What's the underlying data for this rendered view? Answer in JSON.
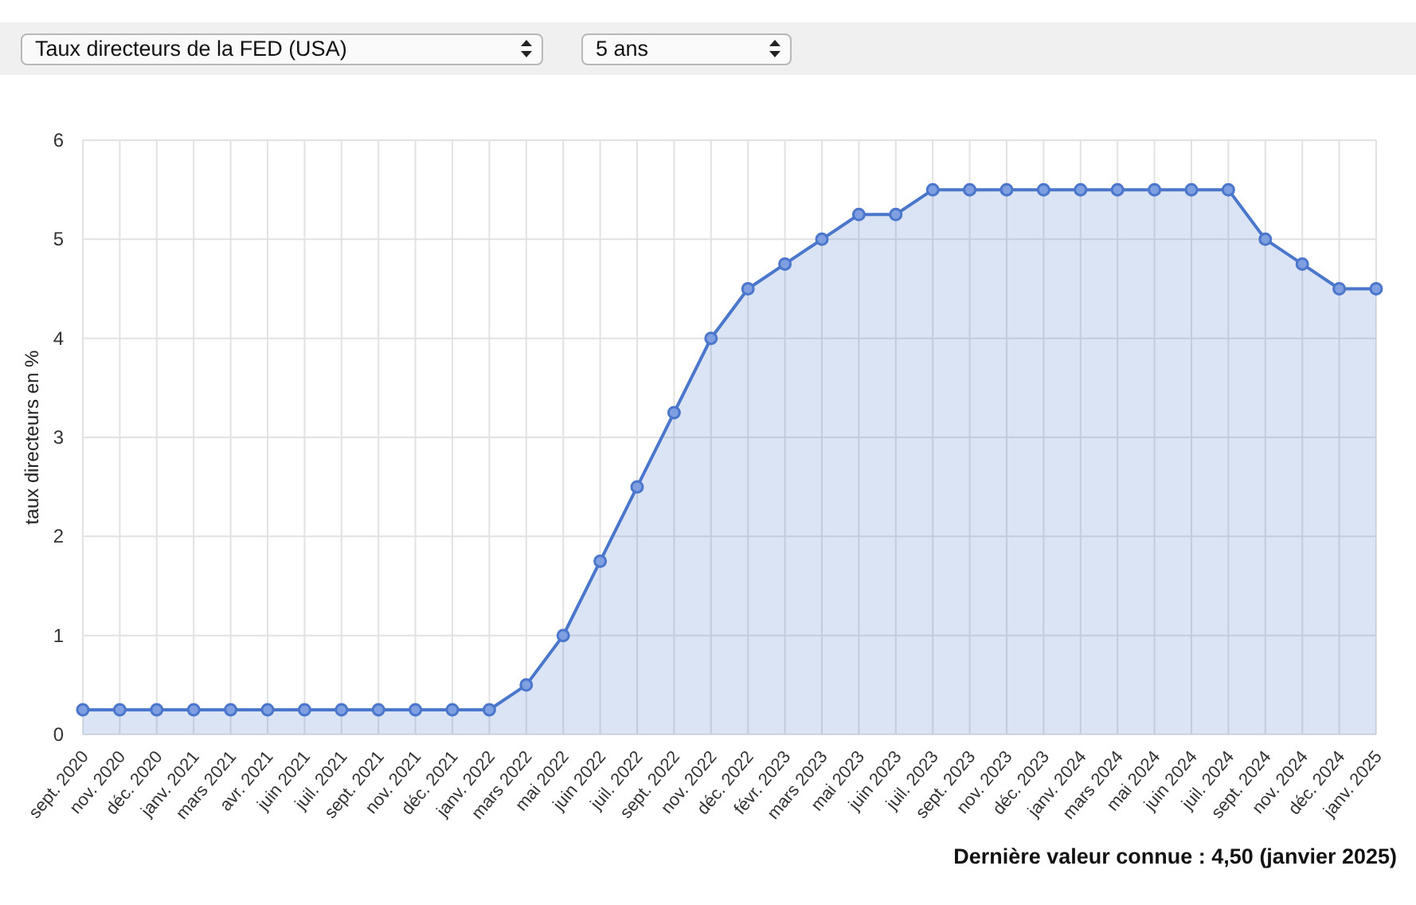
{
  "selects": [
    {
      "value": "Taux directeurs de la FED (USA)",
      "kind": "wide"
    },
    {
      "value": "5 ans",
      "kind": "narrow"
    }
  ],
  "chart_data": {
    "type": "area",
    "ylabel": "taux directeurs en %",
    "ylim": [
      0,
      6
    ],
    "yticks": [
      0,
      1,
      2,
      3,
      4,
      5,
      6
    ],
    "categories": [
      "sept. 2020",
      "nov. 2020",
      "déc. 2020",
      "janv. 2021",
      "mars 2021",
      "avr. 2021",
      "juin 2021",
      "juil. 2021",
      "sept. 2021",
      "nov. 2021",
      "déc. 2021",
      "janv. 2022",
      "mars 2022",
      "mai 2022",
      "juin 2022",
      "juil. 2022",
      "sept. 2022",
      "nov. 2022",
      "déc. 2022",
      "févr. 2023",
      "mars 2023",
      "mai 2023",
      "juin 2023",
      "juil. 2023",
      "sept. 2023",
      "nov. 2023",
      "déc. 2023",
      "janv. 2024",
      "mars 2024",
      "mai 2024",
      "juin 2024",
      "juil. 2024",
      "sept. 2024",
      "nov. 2024",
      "déc. 2024",
      "janv. 2025"
    ],
    "grid": true,
    "series": [
      {
        "color": "#4a76cc",
        "values": [
          0.25,
          0.25,
          0.25,
          0.25,
          0.25,
          0.25,
          0.25,
          0.25,
          0.25,
          0.25,
          0.25,
          0.25,
          0.5,
          1,
          1.75,
          2.5,
          3.25,
          4,
          4.5,
          4.75,
          5,
          5.25,
          5.25,
          5.5,
          5.5,
          5.5,
          5.5,
          5.5,
          5.5,
          5.5,
          5.5,
          5.5,
          5,
          4.75,
          4.5,
          4.5
        ]
      }
    ]
  },
  "footer": "Dernière valeur connue : 4,50 (janvier 2025)"
}
